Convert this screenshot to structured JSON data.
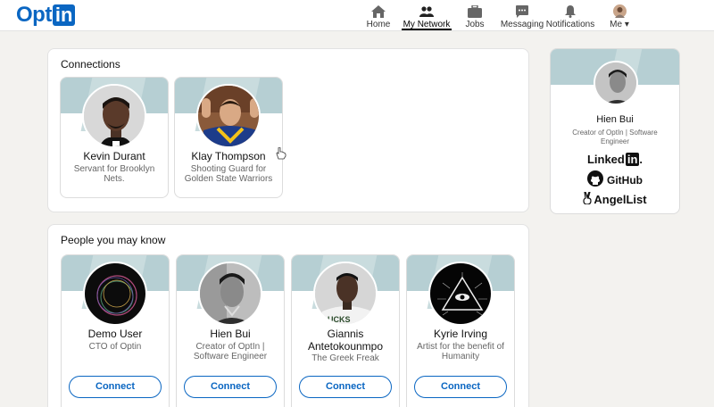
{
  "header": {
    "logo_text": "Opt",
    "logo_box": "in",
    "nav": [
      {
        "label": "Home",
        "icon": "home-icon"
      },
      {
        "label": "My Network",
        "icon": "network-icon"
      },
      {
        "label": "Jobs",
        "icon": "briefcase-icon"
      },
      {
        "label": "Messaging",
        "icon": "messaging-icon"
      },
      {
        "label": "Notifications",
        "icon": "bell-icon"
      },
      {
        "label": "Me",
        "icon": "avatar"
      }
    ],
    "dropdown_glyph": "▾"
  },
  "connections": {
    "title": "Connections",
    "people": [
      {
        "name": "Kevin Durant",
        "desc": "Servant for Brooklyn Nets."
      },
      {
        "name": "Klay Thompson",
        "desc": "Shooting Guard for Golden State Warriors"
      }
    ]
  },
  "suggestions": {
    "title": "People you may know",
    "people": [
      {
        "name": "Demo User",
        "desc": "CTO of Optin",
        "button": "Connect"
      },
      {
        "name": "Hien Bui",
        "desc": "Creator of OptIn | Software Engineer",
        "button": "Connect"
      },
      {
        "name": "Giannis Antetokounmpo",
        "desc": "The Greek Freak",
        "button": "Connect"
      },
      {
        "name": "Kyrie Irving",
        "desc": "Artist for the benefit of Humanity",
        "button": "Connect"
      }
    ]
  },
  "profile": {
    "name": "Hien Bui",
    "desc": "Creator of OptIn | Software Engineer",
    "links": [
      {
        "main": "Linked",
        "box": "in",
        "suffix": "."
      },
      {
        "main": "GitHub"
      },
      {
        "main": "AngelList"
      }
    ]
  },
  "colors": {
    "brand": "#0a66c2",
    "banner": "#b6cfd3",
    "background": "#f3f2ef"
  }
}
